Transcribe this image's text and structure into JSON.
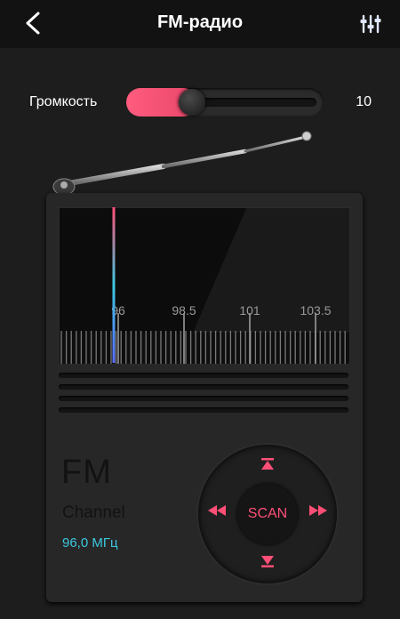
{
  "header": {
    "title": "FM-радио",
    "back_icon": "chevron-left-icon",
    "equalizer_icon": "equalizer-sliders-icon"
  },
  "volume": {
    "label": "Громкость",
    "value": "10",
    "level_fraction": 0.36
  },
  "dial": {
    "tick_labels": [
      "96",
      "98.5",
      "101",
      "103.5"
    ],
    "current_frequency_mhz": 96.0
  },
  "display": {
    "band": "FM",
    "channel_label": "Channel",
    "frequency": "96,0 МГц"
  },
  "controls": {
    "scan_label": "SCAN",
    "up_icon": "seek-up-icon",
    "down_icon": "seek-down-icon",
    "left_icon": "fast-rewind-icon",
    "right_icon": "fast-forward-icon"
  },
  "colors": {
    "accent": "#ff4f76",
    "frequency": "#3cc8e0",
    "background": "#1d1d1d",
    "header": "#121212"
  }
}
